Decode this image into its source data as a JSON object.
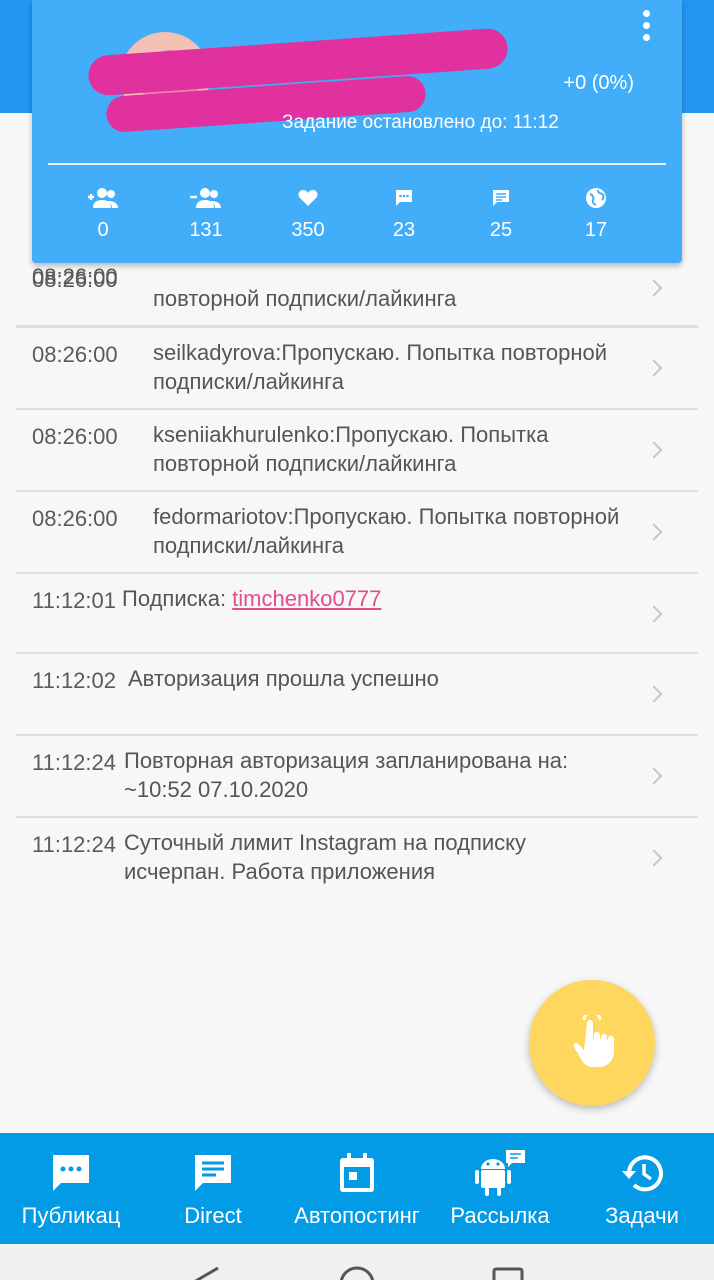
{
  "header": {
    "stats_delta": "+0 (0%)",
    "task_status": "Задание остановлено до: 11:12",
    "stats": [
      {
        "icon": "person-add-icon",
        "value": "0"
      },
      {
        "icon": "person-remove-icon",
        "value": "131"
      },
      {
        "icon": "heart-icon",
        "value": "350"
      },
      {
        "icon": "comment-dots-icon",
        "value": "23"
      },
      {
        "icon": "message-icon",
        "value": "25"
      },
      {
        "icon": "globe-icon",
        "value": "17"
      }
    ]
  },
  "log": [
    {
      "time": "08:26:00",
      "message": "повторной подписки/лайкинга"
    },
    {
      "time": "08:26:00",
      "message": "seilkadyrova:Пропускаю. Попытка повторной подписки/лайкинга"
    },
    {
      "time": "08:26:00",
      "message": "kseniiakhurulenko:Пропускаю. Попытка повторной подписки/лайкинга"
    },
    {
      "time": "08:26:00",
      "message": "fedormariotov:Пропускаю. Попытка повторной подписки/лайкинга"
    },
    {
      "time": "11:12:01",
      "message": "Подписка: ",
      "link": "timchenko0777"
    },
    {
      "time": "11:12:02",
      "message": "Авторизация прошла успешно"
    },
    {
      "time": "11:12:24",
      "message": "Повторная авторизация запланирована на: ~10:52 07.10.2020"
    },
    {
      "time": "11:12:24",
      "message": "Суточный лимит Instagram на подписку исчерпан. Работа приложения"
    }
  ],
  "fab": {
    "icon": "tap-hand-icon"
  },
  "bottom_nav": [
    {
      "label": "Публикац",
      "icon": "chat-dots-icon"
    },
    {
      "label": "Direct",
      "icon": "message-icon"
    },
    {
      "label": "Автопостинг",
      "icon": "calendar-icon"
    },
    {
      "label": "Рассылка",
      "icon": "android-chat-icon"
    },
    {
      "label": "Задачи",
      "icon": "history-icon"
    }
  ],
  "colors": {
    "primary": "#039be5",
    "card": "#42aef9",
    "link": "#e34d8c",
    "fab": "#ffd65e"
  }
}
